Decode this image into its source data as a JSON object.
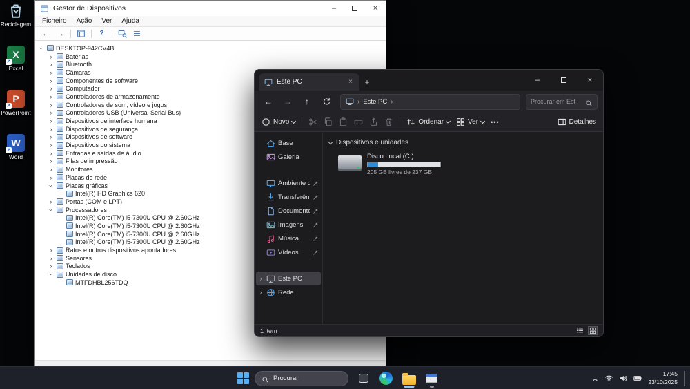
{
  "glyphs": {
    "minimize": "–",
    "close": "×",
    "new_tab": "+",
    "chevron_right": "›",
    "more": "•••",
    "help": "?",
    "back": "←",
    "forward": "→",
    "up": "↑",
    "shortcut_arrow": "↗"
  },
  "desktop": {
    "icons": [
      {
        "id": "recycle-bin",
        "label": "Reciclagem",
        "glyph": ""
      },
      {
        "id": "excel",
        "label": "Excel",
        "glyph": "X"
      },
      {
        "id": "powerpoint",
        "label": "PowerPoint",
        "glyph": "P"
      },
      {
        "id": "word",
        "label": "Word",
        "glyph": "W"
      }
    ]
  },
  "device_manager": {
    "title": "Gestor de Dispositivos",
    "menu": [
      "Ficheiro",
      "Ação",
      "Ver",
      "Ajuda"
    ],
    "tree": [
      {
        "label": "DESKTOP-942CV4B",
        "level": 0,
        "expand": "open",
        "icon": "computer"
      },
      {
        "label": "Baterias",
        "level": 1,
        "expand": "closed",
        "icon": "battery"
      },
      {
        "label": "Bluetooth",
        "level": 1,
        "expand": "closed",
        "icon": "bluetooth"
      },
      {
        "label": "Câmaras",
        "level": 1,
        "expand": "closed",
        "icon": "camera"
      },
      {
        "label": "Componentes de software",
        "level": 1,
        "expand": "closed",
        "icon": "software-component"
      },
      {
        "label": "Computador",
        "level": 1,
        "expand": "closed",
        "icon": "computer"
      },
      {
        "label": "Controladores de armazenamento",
        "level": 1,
        "expand": "closed",
        "icon": "storage"
      },
      {
        "label": "Controladores de som, vídeo e jogos",
        "level": 1,
        "expand": "closed",
        "icon": "audio"
      },
      {
        "label": "Controladores USB (Universal Serial Bus)",
        "level": 1,
        "expand": "closed",
        "icon": "usb"
      },
      {
        "label": "Dispositivos de interface humana",
        "level": 1,
        "expand": "closed",
        "icon": "hid"
      },
      {
        "label": "Dispositivos de segurança",
        "level": 1,
        "expand": "closed",
        "icon": "security"
      },
      {
        "label": "Dispositivos de software",
        "level": 1,
        "expand": "closed",
        "icon": "software"
      },
      {
        "label": "Dispositivos do sistema",
        "level": 1,
        "expand": "closed",
        "icon": "system"
      },
      {
        "label": "Entradas e saídas de áudio",
        "level": 1,
        "expand": "closed",
        "icon": "audio-io"
      },
      {
        "label": "Filas de impressão",
        "level": 1,
        "expand": "closed",
        "icon": "printer"
      },
      {
        "label": "Monitores",
        "level": 1,
        "expand": "closed",
        "icon": "monitor"
      },
      {
        "label": "Placas de rede",
        "level": 1,
        "expand": "closed",
        "icon": "network-adapter"
      },
      {
        "label": "Placas gráficas",
        "level": 1,
        "expand": "open",
        "icon": "gpu"
      },
      {
        "label": "Intel(R) HD Graphics 620",
        "level": 2,
        "expand": "leaf",
        "icon": "gpu"
      },
      {
        "label": "Portas (COM e LPT)",
        "level": 1,
        "expand": "closed",
        "icon": "ports"
      },
      {
        "label": "Processadores",
        "level": 1,
        "expand": "open",
        "icon": "cpu"
      },
      {
        "label": "Intel(R) Core(TM) i5-7300U CPU @ 2.60GHz",
        "level": 2,
        "expand": "leaf",
        "icon": "cpu"
      },
      {
        "label": "Intel(R) Core(TM) i5-7300U CPU @ 2.60GHz",
        "level": 2,
        "expand": "leaf",
        "icon": "cpu"
      },
      {
        "label": "Intel(R) Core(TM) i5-7300U CPU @ 2.60GHz",
        "level": 2,
        "expand": "leaf",
        "icon": "cpu"
      },
      {
        "label": "Intel(R) Core(TM) i5-7300U CPU @ 2.60GHz",
        "level": 2,
        "expand": "leaf",
        "icon": "cpu"
      },
      {
        "label": "Ratos e outros dispositivos apontadores",
        "level": 1,
        "expand": "closed",
        "icon": "mouse"
      },
      {
        "label": "Sensores",
        "level": 1,
        "expand": "closed",
        "icon": "sensor"
      },
      {
        "label": "Teclados",
        "level": 1,
        "expand": "closed",
        "icon": "keyboard"
      },
      {
        "label": "Unidades de disco",
        "level": 1,
        "expand": "open",
        "icon": "disk"
      },
      {
        "label": "MTFDHBL256TDQ",
        "level": 2,
        "expand": "leaf",
        "icon": "disk"
      }
    ]
  },
  "explorer": {
    "tab": "Este PC",
    "breadcrumb": "Este PC",
    "search_placeholder": "Procurar em Est",
    "commands": {
      "new": "Novo",
      "sort": "Ordenar",
      "view": "Ver",
      "details": "Detalhes"
    },
    "sidebar": {
      "groups": [
        {
          "items": [
            {
              "label": "Base",
              "icon": "home"
            },
            {
              "label": "Galeria",
              "icon": "gallery"
            }
          ]
        },
        {
          "items": [
            {
              "label": "Ambiente de tra",
              "icon": "desktop",
              "pinned": true
            },
            {
              "label": "Transferências",
              "icon": "downloads",
              "pinned": true
            },
            {
              "label": "Documentos",
              "icon": "documents",
              "pinned": true
            },
            {
              "label": "Imagens",
              "icon": "pictures",
              "pinned": true
            },
            {
              "label": "Música",
              "icon": "music",
              "pinned": true
            },
            {
              "label": "Vídeos",
              "icon": "videos",
              "pinned": true
            }
          ]
        },
        {
          "items": [
            {
              "label": "Este PC",
              "icon": "pc",
              "selected": true,
              "chevron": true
            },
            {
              "label": "Rede",
              "icon": "network",
              "chevron": true
            }
          ]
        }
      ]
    },
    "content": {
      "group_header": "Dispositivos e unidades",
      "drives": [
        {
          "name": "Disco Local (C:)",
          "detail": "205 GB livres de 237 GB",
          "used_percent": 14
        }
      ]
    },
    "status_text": "1 item"
  },
  "taskbar": {
    "search_placeholder": "Procurar",
    "apps": [
      {
        "id": "task-view",
        "open": false,
        "active": false
      },
      {
        "id": "edge",
        "open": false,
        "active": false
      },
      {
        "id": "file-explorer",
        "open": true,
        "active": true
      },
      {
        "id": "device-manager",
        "open": true,
        "active": false
      }
    ],
    "clock": {
      "time": "17:45",
      "date": "23/10/2025"
    }
  }
}
